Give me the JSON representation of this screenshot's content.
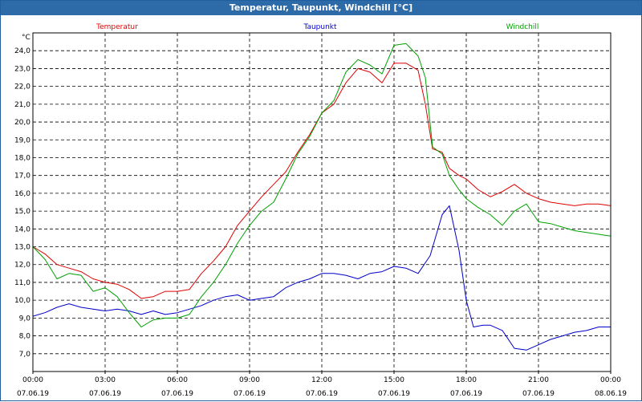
{
  "window": {
    "title": "Temperatur, Taupunkt, Windchill [°C]"
  },
  "chart_data": {
    "type": "line",
    "title": "Temperatur, Taupunkt, Windchill [°C]",
    "ylabel": "°C",
    "ylim": [
      6.0,
      25.0
    ],
    "xlim": [
      0,
      24
    ],
    "y_ticks": [
      "7,0",
      "8,0",
      "9,0",
      "10,0",
      "11,0",
      "12,0",
      "13,0",
      "14,0",
      "15,0",
      "16,0",
      "17,0",
      "18,0",
      "19,0",
      "20,0",
      "21,0",
      "22,0",
      "23,0",
      "24,0"
    ],
    "x_ticks": [
      {
        "time": "00:00",
        "date": "07.06.19"
      },
      {
        "time": "03:00",
        "date": "07.06.19"
      },
      {
        "time": "06:00",
        "date": "07.06.19"
      },
      {
        "time": "09:00",
        "date": "07.06.19"
      },
      {
        "time": "12:00",
        "date": "07.06.19"
      },
      {
        "time": "15:00",
        "date": "07.06.19"
      },
      {
        "time": "18:00",
        "date": "07.06.19"
      },
      {
        "time": "21:00",
        "date": "07.06.19"
      },
      {
        "time": "00:00",
        "date": "08.06.19"
      }
    ],
    "grid": true,
    "legend_position": "top",
    "series": [
      {
        "name": "Temperatur",
        "color": "#e00000",
        "points": [
          [
            0,
            13.0
          ],
          [
            0.5,
            12.6
          ],
          [
            1,
            12.0
          ],
          [
            1.5,
            11.8
          ],
          [
            2,
            11.6
          ],
          [
            2.5,
            11.2
          ],
          [
            3,
            11.0
          ],
          [
            3.5,
            10.9
          ],
          [
            4,
            10.6
          ],
          [
            4.5,
            10.1
          ],
          [
            5,
            10.2
          ],
          [
            5.5,
            10.5
          ],
          [
            6,
            10.5
          ],
          [
            6.5,
            10.6
          ],
          [
            7,
            11.5
          ],
          [
            7.5,
            12.2
          ],
          [
            8,
            13.0
          ],
          [
            8.5,
            14.2
          ],
          [
            9,
            15.0
          ],
          [
            9.5,
            15.8
          ],
          [
            10,
            16.5
          ],
          [
            10.5,
            17.2
          ],
          [
            11,
            18.3
          ],
          [
            11.5,
            19.3
          ],
          [
            12,
            20.5
          ],
          [
            12.5,
            21.0
          ],
          [
            13,
            22.2
          ],
          [
            13.5,
            23.0
          ],
          [
            14,
            22.8
          ],
          [
            14.5,
            22.2
          ],
          [
            15,
            23.3
          ],
          [
            15.5,
            23.3
          ],
          [
            16,
            22.9
          ],
          [
            16.3,
            21.0
          ],
          [
            16.6,
            18.5
          ],
          [
            17,
            18.3
          ],
          [
            17.3,
            17.4
          ],
          [
            17.7,
            17.0
          ],
          [
            18,
            16.8
          ],
          [
            18.5,
            16.2
          ],
          [
            19,
            15.8
          ],
          [
            19.5,
            16.1
          ],
          [
            20,
            16.5
          ],
          [
            20.5,
            16.0
          ],
          [
            21,
            15.7
          ],
          [
            21.5,
            15.5
          ],
          [
            22,
            15.4
          ],
          [
            22.5,
            15.3
          ],
          [
            23,
            15.4
          ],
          [
            23.5,
            15.4
          ],
          [
            24,
            15.3
          ]
        ]
      },
      {
        "name": "Taupunkt",
        "color": "#0000c8",
        "points": [
          [
            0,
            9.1
          ],
          [
            0.5,
            9.3
          ],
          [
            1,
            9.6
          ],
          [
            1.5,
            9.8
          ],
          [
            2,
            9.6
          ],
          [
            2.5,
            9.5
          ],
          [
            3,
            9.4
          ],
          [
            3.5,
            9.5
          ],
          [
            4,
            9.4
          ],
          [
            4.5,
            9.2
          ],
          [
            5,
            9.4
          ],
          [
            5.5,
            9.2
          ],
          [
            6,
            9.3
          ],
          [
            6.5,
            9.5
          ],
          [
            7,
            9.7
          ],
          [
            7.5,
            10.0
          ],
          [
            8,
            10.2
          ],
          [
            8.5,
            10.3
          ],
          [
            9,
            10.0
          ],
          [
            9.5,
            10.1
          ],
          [
            10,
            10.2
          ],
          [
            10.5,
            10.7
          ],
          [
            11,
            11.0
          ],
          [
            11.5,
            11.2
          ],
          [
            12,
            11.5
          ],
          [
            12.5,
            11.5
          ],
          [
            13,
            11.4
          ],
          [
            13.5,
            11.2
          ],
          [
            14,
            11.5
          ],
          [
            14.5,
            11.6
          ],
          [
            15,
            11.9
          ],
          [
            15.5,
            11.8
          ],
          [
            16,
            11.5
          ],
          [
            16.5,
            12.5
          ],
          [
            17,
            14.8
          ],
          [
            17.3,
            15.3
          ],
          [
            17.7,
            12.8
          ],
          [
            18,
            10.0
          ],
          [
            18.3,
            8.5
          ],
          [
            18.7,
            8.6
          ],
          [
            19,
            8.6
          ],
          [
            19.5,
            8.3
          ],
          [
            20,
            7.3
          ],
          [
            20.5,
            7.2
          ],
          [
            21,
            7.5
          ],
          [
            21.5,
            7.8
          ],
          [
            22,
            8.0
          ],
          [
            22.5,
            8.2
          ],
          [
            23,
            8.3
          ],
          [
            23.5,
            8.5
          ],
          [
            24,
            8.5
          ]
        ]
      },
      {
        "name": "Windchill",
        "color": "#00a000",
        "points": [
          [
            0,
            13.0
          ],
          [
            0.5,
            12.3
          ],
          [
            1,
            11.2
          ],
          [
            1.5,
            11.5
          ],
          [
            2,
            11.4
          ],
          [
            2.5,
            10.5
          ],
          [
            3,
            10.7
          ],
          [
            3.5,
            10.2
          ],
          [
            4,
            9.3
          ],
          [
            4.5,
            8.5
          ],
          [
            5,
            8.9
          ],
          [
            5.5,
            9.0
          ],
          [
            6,
            9.0
          ],
          [
            6.5,
            9.2
          ],
          [
            7,
            10.2
          ],
          [
            7.5,
            11.0
          ],
          [
            8,
            12.0
          ],
          [
            8.5,
            13.2
          ],
          [
            9,
            14.2
          ],
          [
            9.5,
            15.0
          ],
          [
            10,
            15.5
          ],
          [
            10.5,
            16.8
          ],
          [
            11,
            18.2
          ],
          [
            11.5,
            19.2
          ],
          [
            12,
            20.5
          ],
          [
            12.5,
            21.2
          ],
          [
            13,
            22.8
          ],
          [
            13.5,
            23.5
          ],
          [
            14,
            23.2
          ],
          [
            14.5,
            22.7
          ],
          [
            15,
            24.3
          ],
          [
            15.5,
            24.4
          ],
          [
            16,
            23.7
          ],
          [
            16.3,
            22.5
          ],
          [
            16.6,
            18.6
          ],
          [
            17,
            18.2
          ],
          [
            17.3,
            17.0
          ],
          [
            17.7,
            16.2
          ],
          [
            18,
            15.7
          ],
          [
            18.5,
            15.2
          ],
          [
            19,
            14.8
          ],
          [
            19.5,
            14.2
          ],
          [
            20,
            15.0
          ],
          [
            20.5,
            15.4
          ],
          [
            21,
            14.4
          ],
          [
            21.5,
            14.3
          ],
          [
            22,
            14.1
          ],
          [
            22.5,
            13.9
          ],
          [
            23,
            13.8
          ],
          [
            23.5,
            13.7
          ],
          [
            24,
            13.6
          ]
        ]
      }
    ]
  }
}
